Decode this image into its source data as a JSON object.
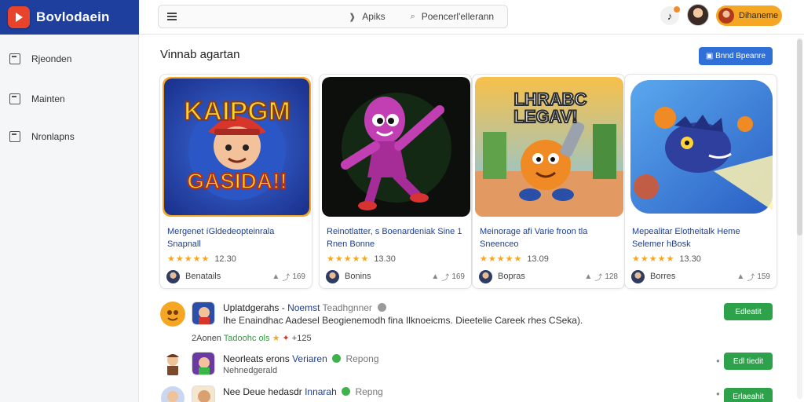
{
  "brand": {
    "name": "Bovlodaein",
    "logo_icon": "play-triangle-icon",
    "color": "#1e3f9e"
  },
  "topbar": {
    "search_a": "Apiks",
    "search_b": "Poencerl'ellerann",
    "notification_count": "0",
    "user_label": "Dihaneme"
  },
  "sidebar": {
    "items": [
      {
        "label": "Rjeonden",
        "icon": "square-icon"
      },
      {
        "label": "Mainten",
        "icon": "briefcase-icon"
      },
      {
        "label": "Nronlapns",
        "icon": "grid-icon"
      }
    ]
  },
  "main": {
    "section_title": "Vinnab agartan",
    "top_button": "▣ Bnnd Bpeanre",
    "accent_color": "#2f6fd6"
  },
  "cards": [
    {
      "title": "Mergenet íGldedeopteinrala Snapnall",
      "stars": "★★★★★",
      "rating": "12.30",
      "dev": "Benatails",
      "downloads": "169",
      "art_text_top": "KAIPGM",
      "art_text_bottom": "GASIDA!!"
    },
    {
      "title": "Reinotlatter, s Boenardeniak Sine 1 Rnen Bonne",
      "stars": "★★★★★",
      "rating": "13.30",
      "dev": "Bonins",
      "downloads": "169",
      "art_text_top": "",
      "art_text_bottom": ""
    },
    {
      "title": "Meinorage afi Varie froon tla Sneenceo",
      "stars": "★★★★★",
      "rating": "13.09",
      "dev": "Bopras",
      "downloads": "128",
      "art_text_top": "LHRABC",
      "art_text_bottom": "LEGAV!"
    },
    {
      "title": "Mepealitar Elotheitalk Heme Selemer hBosk",
      "stars": "★★★★★",
      "rating": "13.30",
      "dev": "Borres",
      "downloads": "159",
      "art_text_top": "",
      "art_text_bottom": ""
    }
  ],
  "list": [
    {
      "name": "Uplatdgerahs -",
      "highlight": "Noemst",
      "extra": "Teadhgnner",
      "text": "Ihe Enaindhac Aadesel Beogienemodh fina Ilknoeicms. Dieetelie Careek rhes CSeka).",
      "meta_prefix": "2Aonen",
      "meta_green": "Tadoohc ols",
      "meta_suffix": "+125",
      "button": "Edleatit"
    },
    {
      "name": "Neorleats erons",
      "highlight": "Veriaren",
      "extra": "Repong",
      "sub": "Nehnedgerald",
      "button": "Edl tiedit"
    },
    {
      "name": "Nee Deue hedasdr",
      "highlight": "Innarah",
      "extra": "Repng",
      "button": "Erlaeahit"
    }
  ]
}
